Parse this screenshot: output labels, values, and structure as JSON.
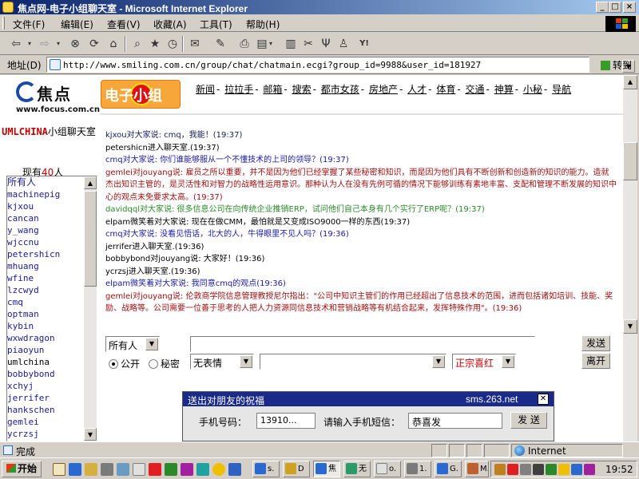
{
  "window": {
    "title": "焦点网-电子小组聊天室 - Microsoft Internet Explorer",
    "controls": [
      "_",
      "□",
      "×"
    ]
  },
  "menu": [
    "文件(F)",
    "编辑(E)",
    "查看(V)",
    "收藏(A)",
    "工具(T)",
    "帮助(H)"
  ],
  "toolbar_icons": [
    "back-icon",
    "forward-icon",
    "stop-icon",
    "refresh-icon",
    "home-icon",
    "search-icon",
    "favorites-icon",
    "history-icon",
    "mail-icon",
    "print-icon",
    "edit-icon",
    "discuss-icon",
    "messenger-icon",
    "tools-icon",
    "user-icon",
    "yahoo-icon"
  ],
  "address": {
    "label": "地址(D)",
    "url": "http://www.smiling.com.cn/group/chat/chatmain.ecgi?group_id=9988&user_id=181927",
    "go_label": "转到"
  },
  "header": {
    "logo_name": "焦点",
    "logo_url": "www.focus.com.cn",
    "group_logo": "电子小组",
    "nav": [
      "新闻",
      "拉拉手",
      "邮箱",
      "搜索",
      "都市女孩",
      "房地产",
      "人才",
      "体育",
      "交通",
      "神算",
      "小秘",
      "导航"
    ],
    "nav_separator": "-"
  },
  "sidebar": {
    "room_prefix": "UMLCHINA",
    "room_suffix": "小组聊天室",
    "online_prefix": "现有",
    "online_count": "40",
    "online_suffix": "人",
    "users": [
      "所有人",
      "machinepig",
      "kjxou",
      "cancan",
      "y_wang",
      "wjccnu",
      "petershicn",
      "mhuang",
      "wfine",
      "lzcwyd",
      "cmq",
      "optman",
      "kybin",
      "wxwdragon",
      "piaoyun",
      "umlchina",
      "bobbybond",
      "xchyj",
      "jerrifer",
      "hankschen",
      "gemlei",
      "ycrzsj"
    ]
  },
  "messages": [
    {
      "text": "kjxou对大家说: cmq，我能！(19:37)",
      "color": "dark"
    },
    {
      "text": "petershicn进入聊天室.(19:37)",
      "color": "black"
    },
    {
      "text": "cmq对大家说: 你们谁能够服从一个不懂技术的上司的领导？(19:37)",
      "color": "blue"
    },
    {
      "text": "gemlei对jouyang说: 雇员之所以重要，并不是因为他们已经掌握了某些秘密和知识，而是因为他们具有不断创新和创造新的知识的能力。造就杰出知识主管的，是灵活性和对智力的战略性运用意识。那种认为人在没有先例可循的情况下能够训练有素地丰富、支配和管理不断发展的知识中心的观点未免要求太高。(19:37)",
      "color": "red"
    },
    {
      "text": "davidqql对大家说: 很多信息公司在向传统企业推销ERP，试问他们自己本身有几个实行了ERP呢？(19:37)",
      "color": "green"
    },
    {
      "text": "elpam微笑着对大家说: 现在在做CMM，最怕就是又变成ISO9000一样的东西(19:37)",
      "color": "black"
    },
    {
      "text": "cmq对大家说: 没看见悟话，北大的人，牛得眼里不见人吗？(19:36)",
      "color": "blue"
    },
    {
      "text": "jerrifer进入聊天室.(19:36)",
      "color": "black"
    },
    {
      "text": "bobbybond对jouyang说: 大家好！(19:36)",
      "color": "black"
    },
    {
      "text": "ycrzsj进入聊天室.(19:36)",
      "color": "black"
    },
    {
      "text": "elpam微笑着对大家说: 我同意cmq的观点(19:36)",
      "color": "blue"
    },
    {
      "text": "gemlei对jouyang说: 伦敦商学院信息管理教授尼尔指出：\"公司中知识主管们的作用已经超出了信息技术的范围，进而包括诸如培训、技能、奖励、战略等。公司需要一位善于思考的人把人力资源同信息技术和营销战略等有机结合起来，发挥特殊作用\"。(19:36)",
      "color": "red"
    }
  ],
  "input_row": {
    "target": "所有人",
    "mode_public": "公开",
    "mode_private": "秘密",
    "expression": "无表情",
    "color_option": "正宗喜红",
    "color_option_hex": "#cc0000",
    "send_label": "发送",
    "leave_label": "离开"
  },
  "sms": {
    "title": "送出对朋友的祝福",
    "site": "sms.263.net",
    "phone_label": "手机号码：",
    "phone_value": "13910...",
    "message_label": "请输入手机短信：",
    "message_value": "恭喜发",
    "send_label": "发 送"
  },
  "status": {
    "text": "完成",
    "zone": "Internet"
  },
  "taskbar": {
    "start_label": "开始",
    "tasks": [
      "s.",
      "D",
      "焦",
      "无",
      "o.",
      "1.",
      "G.",
      "M."
    ],
    "clock": "19:52"
  },
  "colors": {
    "titlebar": "#0a246a",
    "chrome": "#d4d0c8",
    "msg_red": "#a01010",
    "msg_blue": "#1a1aa8",
    "msg_green": "#2a8a2a",
    "sms_header": "#1a2a8a"
  }
}
